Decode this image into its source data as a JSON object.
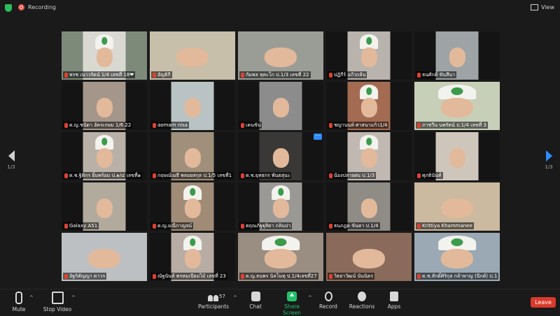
{
  "topbar": {
    "recording_label": "Recording",
    "view_label": "View"
  },
  "nav": {
    "left_page": "1/3",
    "right_page": "1/3"
  },
  "tiles": [
    {
      "name": "พรช เนาวรัตน์ 1/4 เลขที่ 18❤",
      "bg": "#7d8a7a",
      "vbg": "#d9d9d2",
      "hat": true
    },
    {
      "name": "อัญธิกี",
      "bg": "#c7bfa9",
      "vbg": "#c7bfa9",
      "active": true,
      "full": true
    },
    {
      "name": "กัมพล หุตะโก ป.1/3 เลขที่ 22",
      "bg": "#8b8f88",
      "vbg": "#9a9d95",
      "full": true
    },
    {
      "name": "ปฏิกีร์ แก้วกล้น",
      "bg": "#141414",
      "vbg": "#b8b3ad",
      "hat": true
    },
    {
      "name": "ธนศักดิ์ ขันสีนา",
      "bg": "#141414",
      "vbg": "#9ea3a5"
    },
    {
      "name": "ด.ญ.ชนัดา อัครเกษม 1/6.22",
      "bg": "#141414",
      "vbg": "#a4968a"
    },
    {
      "name": "aomam nisa",
      "bg": "#141414",
      "vbg": "#b9c3c4"
    },
    {
      "name": "เคนขัน",
      "bg": "#141414",
      "vbg": "#8c8c8c"
    },
    {
      "name": "ชญานนท์ ศาสนาแก้ว1/4",
      "bg": "#141414",
      "vbg": "#a36b52",
      "hat": true
    },
    {
      "name": "ภาชวีน นพรัตน์ ป.1/4 เลขที่ 3",
      "bg": "#c8cfb8",
      "vbg": "#c8cfb8",
      "full": true,
      "hat": true
    },
    {
      "name": "ด.ช.ฐิติกร ยิ้มพร้อม ป.๑/๔ เลขที่๑",
      "bg": "#141414",
      "vbg": "#b9b1a8",
      "hat": true
    },
    {
      "name": "กฤษณ์เมธี พลอยสกุล ป.1/5 เลขที่1",
      "bg": "#141414",
      "vbg": "#9f8f7b"
    },
    {
      "name": "ด.ช.ยุทธกร พันธสุนะ",
      "bg": "#141414",
      "vbg": "#3a3836",
      "more": true
    },
    {
      "name": "น้องปลายฝน ป.1/3",
      "bg": "#141414",
      "vbg": "#c1b9b1",
      "hat": true
    },
    {
      "name": "ศุภธินันท์",
      "bg": "#141414",
      "vbg": "#cfc6bb"
    },
    {
      "name": "Galaxy A51",
      "bg": "#141414",
      "vbg": "#b2aa9d"
    },
    {
      "name": "ด.ญ.มณีกาญจน์",
      "bg": "#141414",
      "vbg": "#a08b77",
      "hat": true
    },
    {
      "name": "ตฤณภัฐฐุสิตา กลินปา",
      "bg": "#141414",
      "vbg": "#9b9995",
      "hat": true
    },
    {
      "name": "ธนภฎด ขันคา ป.1/4",
      "bg": "#141414",
      "vbg": "#8f8b85"
    },
    {
      "name": "Krittiya Khammanee",
      "bg": "#cbb9a0",
      "vbg": "#cbb9a0",
      "full": true
    },
    {
      "name": "อัฐกิตัญญา ดาวร",
      "bg": "#bcc0c3",
      "vbg": "#bcc0c3",
      "full": true
    },
    {
      "name": "ณัฐนันท์ พรหมเนียมไม้ เลขที่ 23",
      "bg": "#141414",
      "vbg": "#b7ada4",
      "hat": true
    },
    {
      "name": "ด.ญ.ธนพร นิลโมทุ ป.1/4เลขที่27",
      "bg": "#9a8d82",
      "vbg": "#9a8d82",
      "full": true,
      "hat": true
    },
    {
      "name": "วิธยาวัฒน์ นันนิตร",
      "bg": "#8a6a5a",
      "vbg": "#8a6a5a",
      "full": true
    },
    {
      "name": "ด.ช.สักดิ์ศิริกุล กล้าหาญ (นีกต์) ป.1",
      "bg": "#9aa9b3",
      "vbg": "#9aa9b3",
      "full": true,
      "hat": true
    }
  ],
  "toolbar": {
    "mute_label": "Mute",
    "stop_video_label": "Stop Video",
    "participants_label": "Participants",
    "participants_count": "57",
    "chat_label": "Chat",
    "share_label": "Share Screen",
    "record_label": "Record",
    "reactions_label": "Reactions",
    "apps_label": "Apps",
    "leave_label": "Leave"
  },
  "colors": {
    "accent": "#2d8cff",
    "share": "#23c26b",
    "leave": "#d93a2b",
    "active_border": "#e8d84a",
    "muted": "#e0412f"
  }
}
